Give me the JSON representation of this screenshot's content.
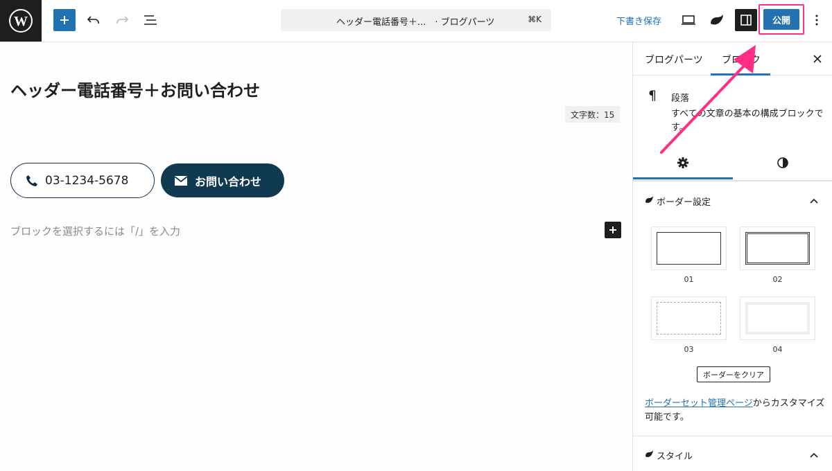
{
  "toolbar": {
    "add_block_label": "+",
    "command_title": "ヘッダー電話番号＋...　· ブログパーツ",
    "command_shortcut": "⌘K",
    "save_draft_label": "下書き保存",
    "publish_label": "公開"
  },
  "editor": {
    "post_title": "ヘッダー電話番号＋お問い合わせ",
    "char_count": "文字数：15",
    "tel_button_label": "03-1234-5678",
    "contact_button_label": "お問い合わせ",
    "placeholder": "ブロックを選択するには「/」を入力"
  },
  "sidebar": {
    "tabs": [
      {
        "label": "ブログパーツ"
      },
      {
        "label": "ブロック"
      }
    ],
    "block": {
      "name": "段落",
      "description": "すべての文章の基本の構成ブロックです。"
    },
    "border_panel": {
      "title": "ボーダー設定",
      "options": [
        {
          "label": "01"
        },
        {
          "label": "02"
        },
        {
          "label": "03"
        },
        {
          "label": "04"
        }
      ],
      "clear_label": "ボーダーをクリア",
      "note_link": "ボーダーセット管理ページ",
      "note_text": "からカスタマイズ可能です。"
    },
    "style_panel": {
      "title": "スタイル"
    }
  },
  "colors": {
    "accent": "#2271b1",
    "highlight": "#ff2d84",
    "contact_bg": "#0f3a4f",
    "dark": "#1e1e1e"
  }
}
